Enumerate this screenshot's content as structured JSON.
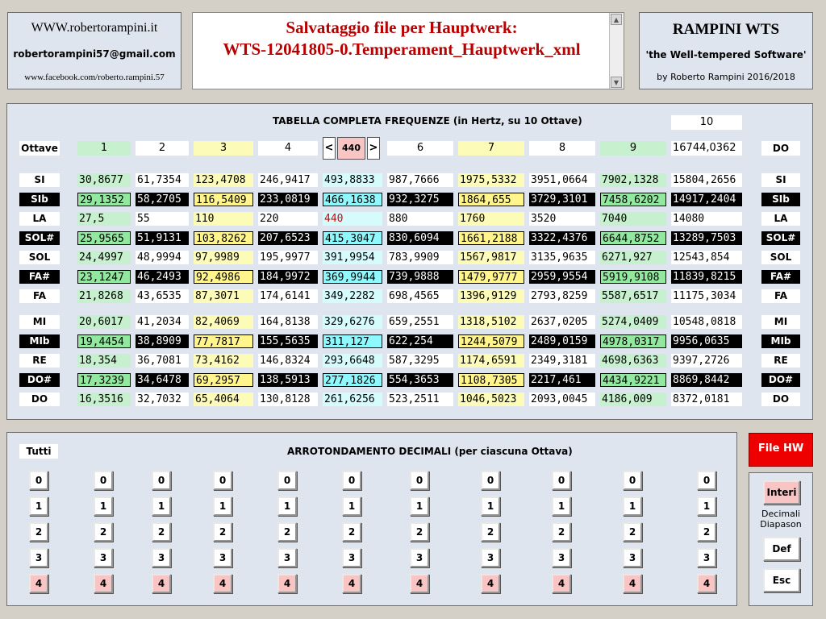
{
  "site": {
    "url": "WWW.robertorampini.it",
    "email": "robertorampini57@gmail.com",
    "facebook": "www.facebook.com/roberto.rampini.57"
  },
  "title": {
    "line1": "Salvataggio file per Hauptwerk:",
    "line2": "WTS-12041805-0.Temperament_Hauptwerk_xml"
  },
  "brand": {
    "name": "RAMPINI WTS",
    "tagline": "'the Well-tempered Software'",
    "byline": "by Roberto Rampini 2016/2018"
  },
  "table": {
    "caption": "TABELLA COMPLETA FREQUENZE (in Hertz, su 10 Ottave)",
    "octave_label": "Ottave",
    "octave_ten": "10",
    "octave_headers": [
      "1",
      "2",
      "3",
      "4",
      "",
      "6",
      "7",
      "8",
      "9",
      "16744,0362"
    ],
    "header_right": "DO",
    "diapason": {
      "prev_label": "<",
      "value": "440",
      "next_label": ">"
    },
    "rows": [
      {
        "note": "SI",
        "style": "white",
        "values": [
          "30,8677",
          "61,7354",
          "123,4708",
          "246,9417",
          "493,8833",
          "987,7666",
          "1975,5332",
          "3951,0664",
          "7902,1328",
          "15804,2656"
        ]
      },
      {
        "note": "SIb",
        "style": "black",
        "values": [
          "29,1352",
          "58,2705",
          "116,5409",
          "233,0819",
          "466,1638",
          "932,3275",
          "1864,655",
          "3729,3101",
          "7458,6202",
          "14917,2404"
        ]
      },
      {
        "note": "LA",
        "style": "white",
        "values": [
          "27,5",
          "55",
          "110",
          "220",
          "440",
          "880",
          "1760",
          "3520",
          "7040",
          "14080"
        ]
      },
      {
        "note": "SOL#",
        "style": "black",
        "values": [
          "25,9565",
          "51,9131",
          "103,8262",
          "207,6523",
          "415,3047",
          "830,6094",
          "1661,2188",
          "3322,4376",
          "6644,8752",
          "13289,7503"
        ]
      },
      {
        "note": "SOL",
        "style": "white",
        "values": [
          "24,4997",
          "48,9994",
          "97,9989",
          "195,9977",
          "391,9954",
          "783,9909",
          "1567,9817",
          "3135,9635",
          "6271,927",
          "12543,854"
        ]
      },
      {
        "note": "FA#",
        "style": "black",
        "values": [
          "23,1247",
          "46,2493",
          "92,4986",
          "184,9972",
          "369,9944",
          "739,9888",
          "1479,9777",
          "2959,9554",
          "5919,9108",
          "11839,8215"
        ]
      },
      {
        "note": "FA",
        "style": "white",
        "values": [
          "21,8268",
          "43,6535",
          "87,3071",
          "174,6141",
          "349,2282",
          "698,4565",
          "1396,9129",
          "2793,8259",
          "5587,6517",
          "11175,3034"
        ]
      },
      {
        "note": "MI",
        "style": "white",
        "values": [
          "20,6017",
          "41,2034",
          "82,4069",
          "164,8138",
          "329,6276",
          "659,2551",
          "1318,5102",
          "2637,0205",
          "5274,0409",
          "10548,0818"
        ]
      },
      {
        "note": "MIb",
        "style": "black",
        "values": [
          "19,4454",
          "38,8909",
          "77,7817",
          "155,5635",
          "311,127",
          "622,254",
          "1244,5079",
          "2489,0159",
          "4978,0317",
          "9956,0635"
        ]
      },
      {
        "note": "RE",
        "style": "white",
        "values": [
          "18,354",
          "36,7081",
          "73,4162",
          "146,8324",
          "293,6648",
          "587,3295",
          "1174,6591",
          "2349,3181",
          "4698,6363",
          "9397,2726"
        ]
      },
      {
        "note": "DO#",
        "style": "black",
        "values": [
          "17,3239",
          "34,6478",
          "69,2957",
          "138,5913",
          "277,1826",
          "554,3653",
          "1108,7305",
          "2217,461",
          "4434,9221",
          "8869,8442"
        ]
      },
      {
        "note": "DO",
        "style": "white",
        "values": [
          "16,3516",
          "32,7032",
          "65,4064",
          "130,8128",
          "261,6256",
          "523,2511",
          "1046,5023",
          "2093,0045",
          "4186,009",
          "8372,0181"
        ]
      }
    ]
  },
  "rounding": {
    "caption": "ARROTONDAMENTO DECIMALI (per ciascuna Ottava)",
    "all_label": "Tutti",
    "levels": [
      "0",
      "1",
      "2",
      "3",
      "4"
    ],
    "selected_level": "4",
    "columns": 11
  },
  "side": {
    "file_hw_label": "File HW",
    "interi_label": "Interi",
    "note_line1": "Decimali",
    "note_line2": "Diapason",
    "def_label": "Def",
    "esc_label": "Esc"
  },
  "colors": {
    "accent_red": "#ee0000",
    "title_red": "#b80000",
    "panel_bg": "#dfe5ee"
  }
}
